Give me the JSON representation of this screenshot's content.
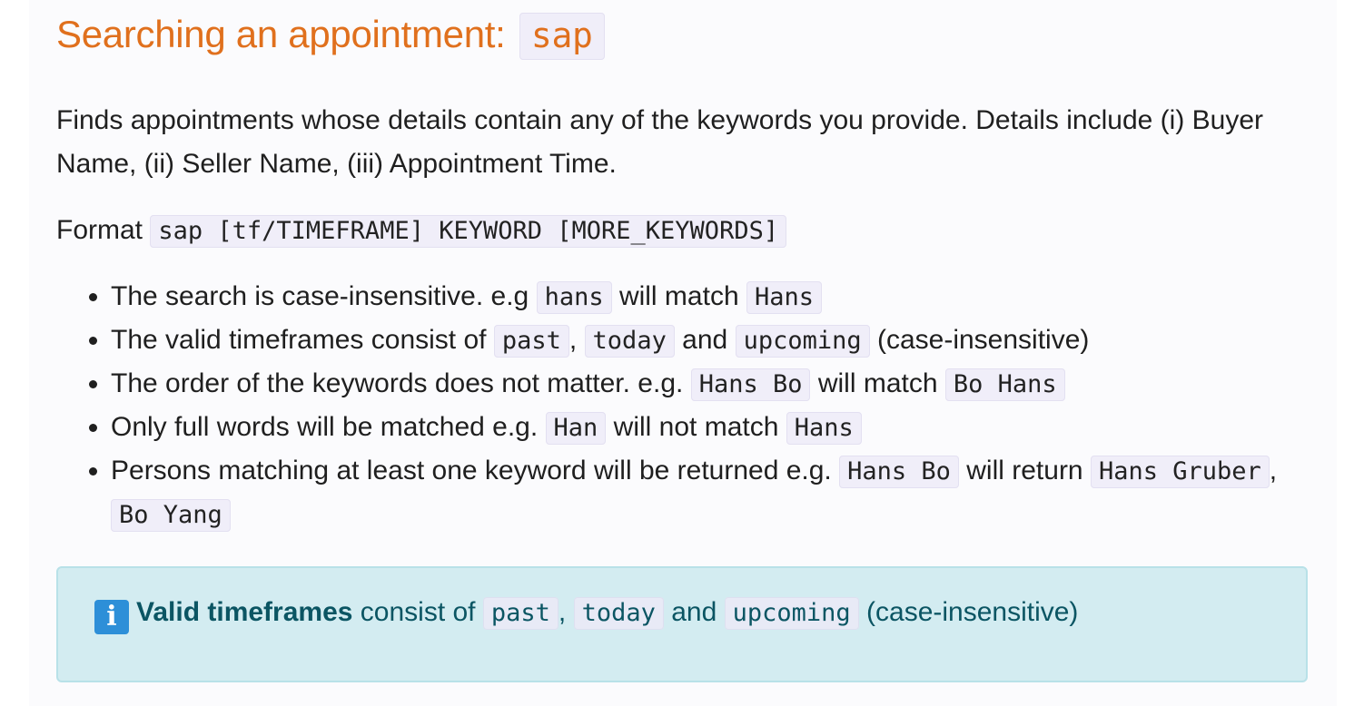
{
  "heading": {
    "text": "Searching an appointment:",
    "command": "sap"
  },
  "description": "Finds appointments whose details contain any of the keywords you provide. Details include (i) Buyer Name, (ii) Seller Name, (iii) Appointment Time.",
  "format": {
    "label": "Format",
    "syntax": "sap [tf/TIMEFRAME] KEYWORD [MORE_KEYWORDS]"
  },
  "rules": [
    {
      "t1": "The search is case-insensitive. e.g",
      "c1": "hans",
      "t2": "will match",
      "c2": "Hans"
    },
    {
      "t1": "The valid timeframes consist of",
      "c1": "past",
      "sep1": ",",
      "c2": "today",
      "t2": "and",
      "c3": "upcoming",
      "t3": "(case-insensitive)"
    },
    {
      "t1": "The order of the keywords does not matter. e.g.",
      "c1": "Hans Bo",
      "t2": "will match",
      "c2": "Bo Hans"
    },
    {
      "t1": "Only full words will be matched e.g.",
      "c1": "Han",
      "t2": "will not match",
      "c2": "Hans"
    },
    {
      "t1": "Persons matching at least one keyword will be returned e.g.",
      "c1": "Hans Bo",
      "t2": "will return",
      "c2": "Hans Gruber",
      "sep1": ",",
      "c3": "Bo Yang"
    }
  ],
  "callout": {
    "icon": "info-icon",
    "icon_glyph": "i",
    "bold": "Valid timeframes",
    "t1": "consist of",
    "c1": "past",
    "sep1": ",",
    "c2": "today",
    "t2": "and",
    "c3": "upcoming",
    "t3": "(case-insensitive)"
  }
}
